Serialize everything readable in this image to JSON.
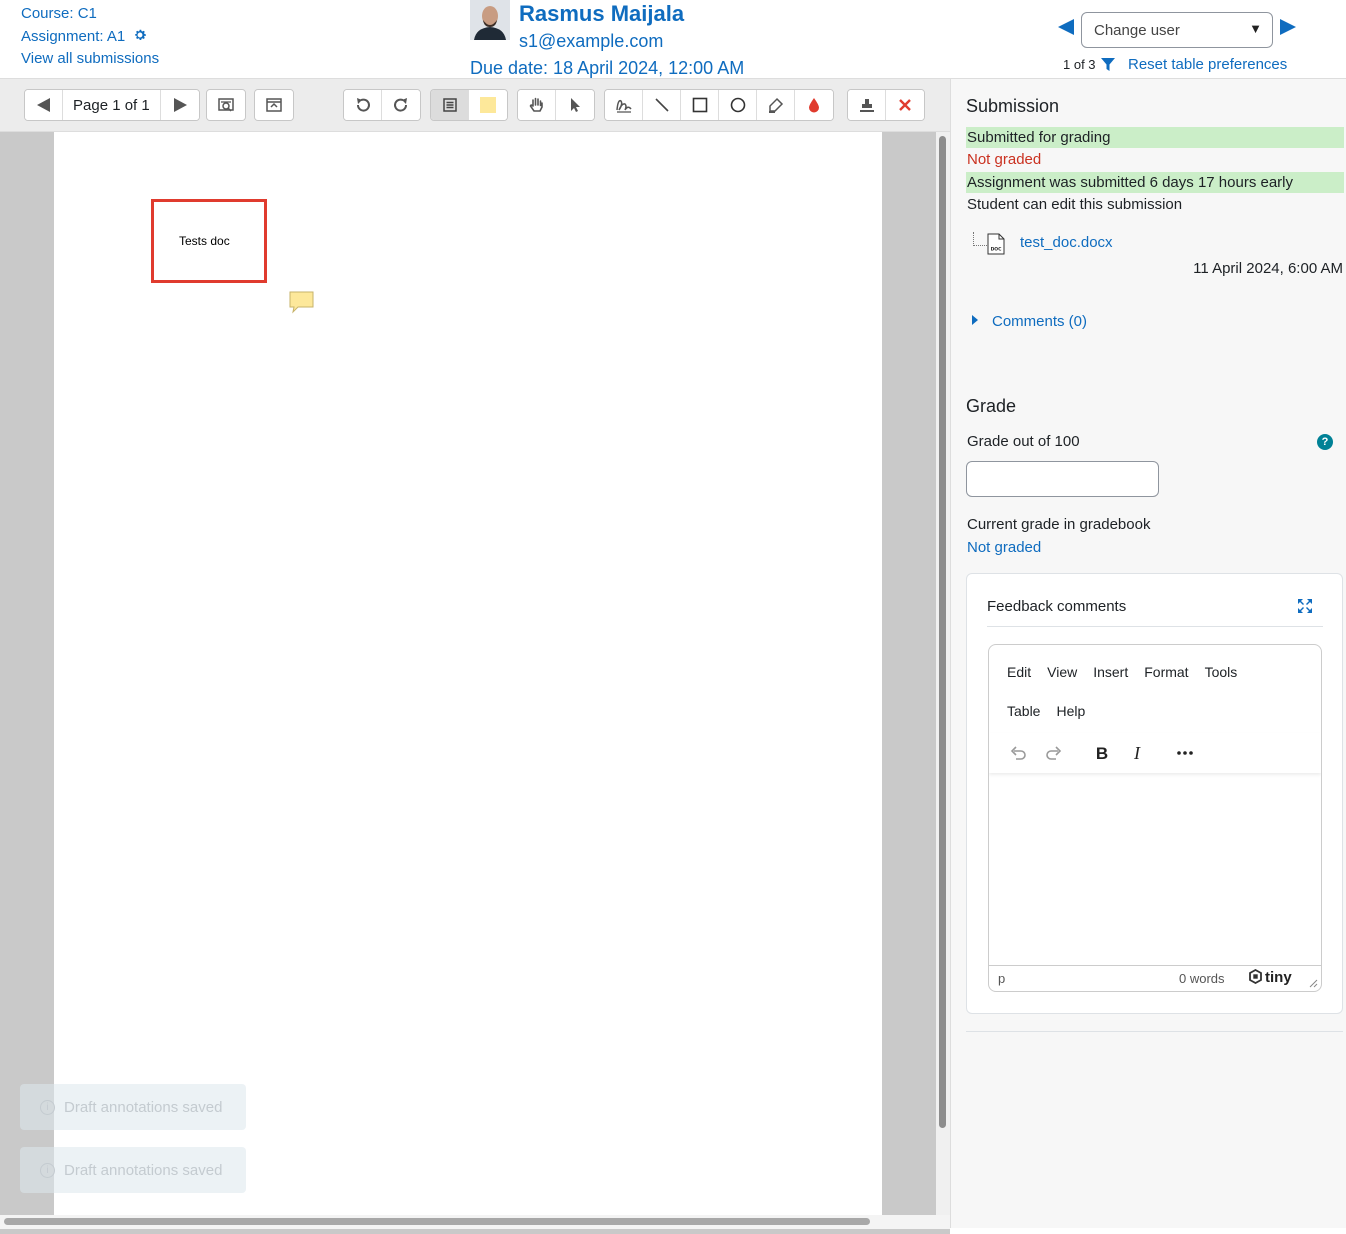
{
  "header": {
    "course": "Course: C1",
    "assignment": "Assignment: A1",
    "view_all": "View all submissions",
    "user_name": "Rasmus Maijala",
    "user_email": "s1@example.com",
    "due_date": "Due date: 18 April 2024, 12:00 AM",
    "change_user_placeholder": "Change user",
    "count": "1 of 3",
    "reset_pref": "Reset table preferences"
  },
  "toolbar": {
    "page_label": "Page 1 of 1",
    "active_color": "#fde89a",
    "stamp_color_red": "#e03b2e"
  },
  "document": {
    "textbox_text": "Tests doc",
    "textbox_border_color": "#e03b2e"
  },
  "toasts": [
    {
      "text": "Draft annotations saved"
    },
    {
      "text": "Draft annotations saved"
    }
  ],
  "submission": {
    "heading": "Submission",
    "status": "Submitted for grading",
    "grading_status": "Not graded",
    "timing": "Assignment was submitted 6 days 17 hours early",
    "edit_status": "Student can edit this submission",
    "file_name": "test_doc.docx",
    "file_date": "11 April 2024, 6:00 AM",
    "comments": "Comments (0)"
  },
  "grade": {
    "heading": "Grade",
    "grade_label": "Grade out of 100",
    "grade_value": "",
    "current_label": "Current grade in gradebook",
    "current_value": "Not graded"
  },
  "feedback": {
    "title": "Feedback comments",
    "menu": [
      "Edit",
      "View",
      "Insert",
      "Format",
      "Tools",
      "Table",
      "Help"
    ],
    "status_path": "p",
    "word_count": "0 words",
    "brand": "tiny"
  },
  "colors": {
    "link": "#0f6cbf",
    "success_bg": "#cbeec8",
    "danger_text": "#ca3120",
    "help": "#008196"
  }
}
